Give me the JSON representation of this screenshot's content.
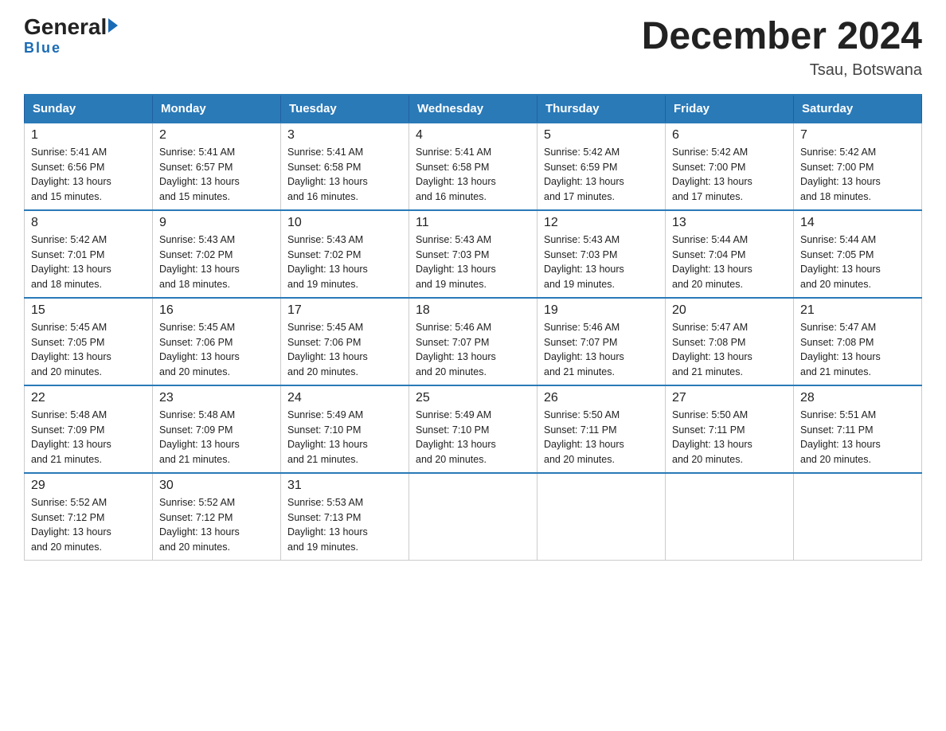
{
  "header": {
    "logo_general": "General",
    "logo_blue": "Blue",
    "month_title": "December 2024",
    "location": "Tsau, Botswana"
  },
  "days_of_week": [
    "Sunday",
    "Monday",
    "Tuesday",
    "Wednesday",
    "Thursday",
    "Friday",
    "Saturday"
  ],
  "weeks": [
    [
      {
        "day": "1",
        "sunrise": "5:41 AM",
        "sunset": "6:56 PM",
        "daylight": "13 hours and 15 minutes."
      },
      {
        "day": "2",
        "sunrise": "5:41 AM",
        "sunset": "6:57 PM",
        "daylight": "13 hours and 15 minutes."
      },
      {
        "day": "3",
        "sunrise": "5:41 AM",
        "sunset": "6:58 PM",
        "daylight": "13 hours and 16 minutes."
      },
      {
        "day": "4",
        "sunrise": "5:41 AM",
        "sunset": "6:58 PM",
        "daylight": "13 hours and 16 minutes."
      },
      {
        "day": "5",
        "sunrise": "5:42 AM",
        "sunset": "6:59 PM",
        "daylight": "13 hours and 17 minutes."
      },
      {
        "day": "6",
        "sunrise": "5:42 AM",
        "sunset": "7:00 PM",
        "daylight": "13 hours and 17 minutes."
      },
      {
        "day": "7",
        "sunrise": "5:42 AM",
        "sunset": "7:00 PM",
        "daylight": "13 hours and 18 minutes."
      }
    ],
    [
      {
        "day": "8",
        "sunrise": "5:42 AM",
        "sunset": "7:01 PM",
        "daylight": "13 hours and 18 minutes."
      },
      {
        "day": "9",
        "sunrise": "5:43 AM",
        "sunset": "7:02 PM",
        "daylight": "13 hours and 18 minutes."
      },
      {
        "day": "10",
        "sunrise": "5:43 AM",
        "sunset": "7:02 PM",
        "daylight": "13 hours and 19 minutes."
      },
      {
        "day": "11",
        "sunrise": "5:43 AM",
        "sunset": "7:03 PM",
        "daylight": "13 hours and 19 minutes."
      },
      {
        "day": "12",
        "sunrise": "5:43 AM",
        "sunset": "7:03 PM",
        "daylight": "13 hours and 19 minutes."
      },
      {
        "day": "13",
        "sunrise": "5:44 AM",
        "sunset": "7:04 PM",
        "daylight": "13 hours and 20 minutes."
      },
      {
        "day": "14",
        "sunrise": "5:44 AM",
        "sunset": "7:05 PM",
        "daylight": "13 hours and 20 minutes."
      }
    ],
    [
      {
        "day": "15",
        "sunrise": "5:45 AM",
        "sunset": "7:05 PM",
        "daylight": "13 hours and 20 minutes."
      },
      {
        "day": "16",
        "sunrise": "5:45 AM",
        "sunset": "7:06 PM",
        "daylight": "13 hours and 20 minutes."
      },
      {
        "day": "17",
        "sunrise": "5:45 AM",
        "sunset": "7:06 PM",
        "daylight": "13 hours and 20 minutes."
      },
      {
        "day": "18",
        "sunrise": "5:46 AM",
        "sunset": "7:07 PM",
        "daylight": "13 hours and 20 minutes."
      },
      {
        "day": "19",
        "sunrise": "5:46 AM",
        "sunset": "7:07 PM",
        "daylight": "13 hours and 21 minutes."
      },
      {
        "day": "20",
        "sunrise": "5:47 AM",
        "sunset": "7:08 PM",
        "daylight": "13 hours and 21 minutes."
      },
      {
        "day": "21",
        "sunrise": "5:47 AM",
        "sunset": "7:08 PM",
        "daylight": "13 hours and 21 minutes."
      }
    ],
    [
      {
        "day": "22",
        "sunrise": "5:48 AM",
        "sunset": "7:09 PM",
        "daylight": "13 hours and 21 minutes."
      },
      {
        "day": "23",
        "sunrise": "5:48 AM",
        "sunset": "7:09 PM",
        "daylight": "13 hours and 21 minutes."
      },
      {
        "day": "24",
        "sunrise": "5:49 AM",
        "sunset": "7:10 PM",
        "daylight": "13 hours and 21 minutes."
      },
      {
        "day": "25",
        "sunrise": "5:49 AM",
        "sunset": "7:10 PM",
        "daylight": "13 hours and 20 minutes."
      },
      {
        "day": "26",
        "sunrise": "5:50 AM",
        "sunset": "7:11 PM",
        "daylight": "13 hours and 20 minutes."
      },
      {
        "day": "27",
        "sunrise": "5:50 AM",
        "sunset": "7:11 PM",
        "daylight": "13 hours and 20 minutes."
      },
      {
        "day": "28",
        "sunrise": "5:51 AM",
        "sunset": "7:11 PM",
        "daylight": "13 hours and 20 minutes."
      }
    ],
    [
      {
        "day": "29",
        "sunrise": "5:52 AM",
        "sunset": "7:12 PM",
        "daylight": "13 hours and 20 minutes."
      },
      {
        "day": "30",
        "sunrise": "5:52 AM",
        "sunset": "7:12 PM",
        "daylight": "13 hours and 20 minutes."
      },
      {
        "day": "31",
        "sunrise": "5:53 AM",
        "sunset": "7:13 PM",
        "daylight": "13 hours and 19 minutes."
      },
      null,
      null,
      null,
      null
    ]
  ],
  "labels": {
    "sunrise": "Sunrise:",
    "sunset": "Sunset:",
    "daylight": "Daylight:"
  }
}
